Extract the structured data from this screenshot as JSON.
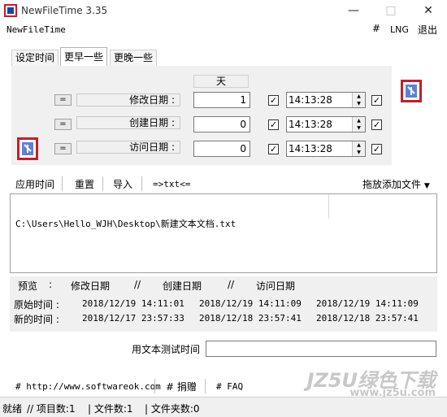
{
  "window": {
    "title": "NewFileTime 3.35",
    "minimize": "—",
    "maximize": "□",
    "close": "✕"
  },
  "menu": {
    "app": "NewFileTime",
    "hash": "#",
    "lng": "LNG",
    "exit": "退出"
  },
  "tabs": [
    {
      "label": "设定时间"
    },
    {
      "label": "更早一些"
    },
    {
      "label": "更晚一些"
    }
  ],
  "panel": {
    "day_header": "天",
    "rows": [
      {
        "eq": "=",
        "label": "修改日期 :",
        "days": "1",
        "time": "14:13:28"
      },
      {
        "eq": "=",
        "label": "创建日期 :",
        "days": "0",
        "time": "14:13:28"
      },
      {
        "eq": "=",
        "label": "访问日期 :",
        "days": "0",
        "time": "14:13:28"
      }
    ]
  },
  "toolbar": {
    "apply": "应用时间",
    "reset": "重置",
    "import": "导入",
    "txt": "=>txt<=",
    "drag": "拖放添加文件"
  },
  "files": [
    "C:\\Users\\Hello_WJH\\Desktop\\新建文本文档.txt"
  ],
  "preview": {
    "header": {
      "label": "预览",
      "colon": ":",
      "modify": "修改日期",
      "sep1": "//",
      "create": "创建日期",
      "sep2": "//",
      "access": "访问日期"
    },
    "original": {
      "label": "原始时间 :",
      "modify": "2018/12/19 14:11:01",
      "create": "2018/12/19 14:11:09",
      "access": "2018/12/19 14:11:09"
    },
    "new": {
      "label": "新的时间 :",
      "modify": "2018/12/17 23:57:33",
      "create": "2018/12/18 23:57:41",
      "access": "2018/12/18 23:57:41"
    }
  },
  "test": {
    "label": "用文本测试时间",
    "value": ""
  },
  "links": {
    "site": "# http://www.softwareok.com",
    "donate": "# 捐赠",
    "faq": "# FAQ"
  },
  "status": {
    "ready": "就绪",
    "items": "// 项目数:1",
    "files": "| 文件数:1",
    "folders": "| 文件夹数:0"
  },
  "watermark": {
    "line1": "JZ5U绿色下载",
    "line2": "www.jz5u.com"
  },
  "colors": {
    "panel_bg": "#f0f0f0",
    "icon_red": "#c0202a",
    "icon_blue": "#2040a0"
  }
}
